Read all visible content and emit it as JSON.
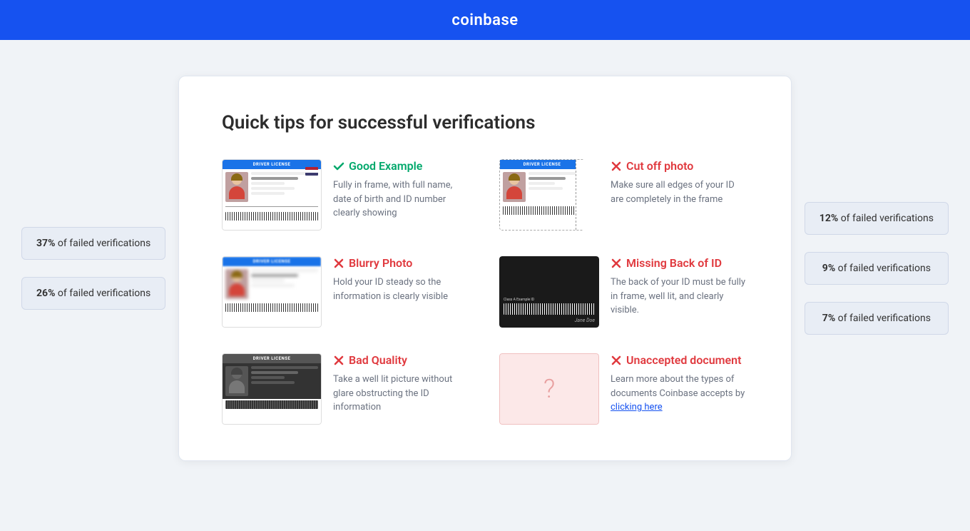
{
  "header": {
    "logo": "coinbase"
  },
  "page": {
    "title": "Quick tips for successful verifications"
  },
  "side_badges_left": [
    {
      "percent": "37%",
      "label": "of failed verifications"
    },
    {
      "percent": "26%",
      "label": "of failed verifications"
    }
  ],
  "side_badges_right": [
    {
      "percent": "12%",
      "label": "of failed verifications"
    },
    {
      "percent": "9%",
      "label": "of failed verifications"
    },
    {
      "percent": "7%",
      "label": "of failed verifications"
    }
  ],
  "tips": [
    {
      "id": "good-example",
      "type": "good",
      "icon": "check",
      "label": "Good Example",
      "description": "Fully in frame, with full name, date of birth and ID number clearly showing",
      "card_type": "normal"
    },
    {
      "id": "cut-off-photo",
      "type": "bad",
      "icon": "x",
      "label": "Cut off photo",
      "description": "Make sure all edges of your ID are completely in the frame",
      "card_type": "cutoff"
    },
    {
      "id": "blurry-photo",
      "type": "bad",
      "icon": "x",
      "label": "Blurry Photo",
      "description": "Hold your ID steady so the information is clearly visible",
      "card_type": "blurry"
    },
    {
      "id": "missing-back",
      "type": "bad",
      "icon": "x",
      "label": "Missing Back of ID",
      "description": "The back of your ID must be fully in frame, well lit, and clearly visible.",
      "card_type": "back"
    },
    {
      "id": "bad-quality",
      "type": "bad",
      "icon": "x",
      "label": "Bad Quality",
      "description": "Take a well lit picture without glare obstructing the ID information",
      "card_type": "dark"
    },
    {
      "id": "unaccepted-document",
      "type": "bad",
      "icon": "x",
      "label": "Unaccepted document",
      "description": "Learn more about the types of documents Coinbase accepts by",
      "link_text": "clicking here",
      "link_href": "#",
      "card_type": "unknown"
    }
  ],
  "dl_header_text": "DRIVER LICENSE",
  "dl_id_back_text": "Class A Example ID"
}
